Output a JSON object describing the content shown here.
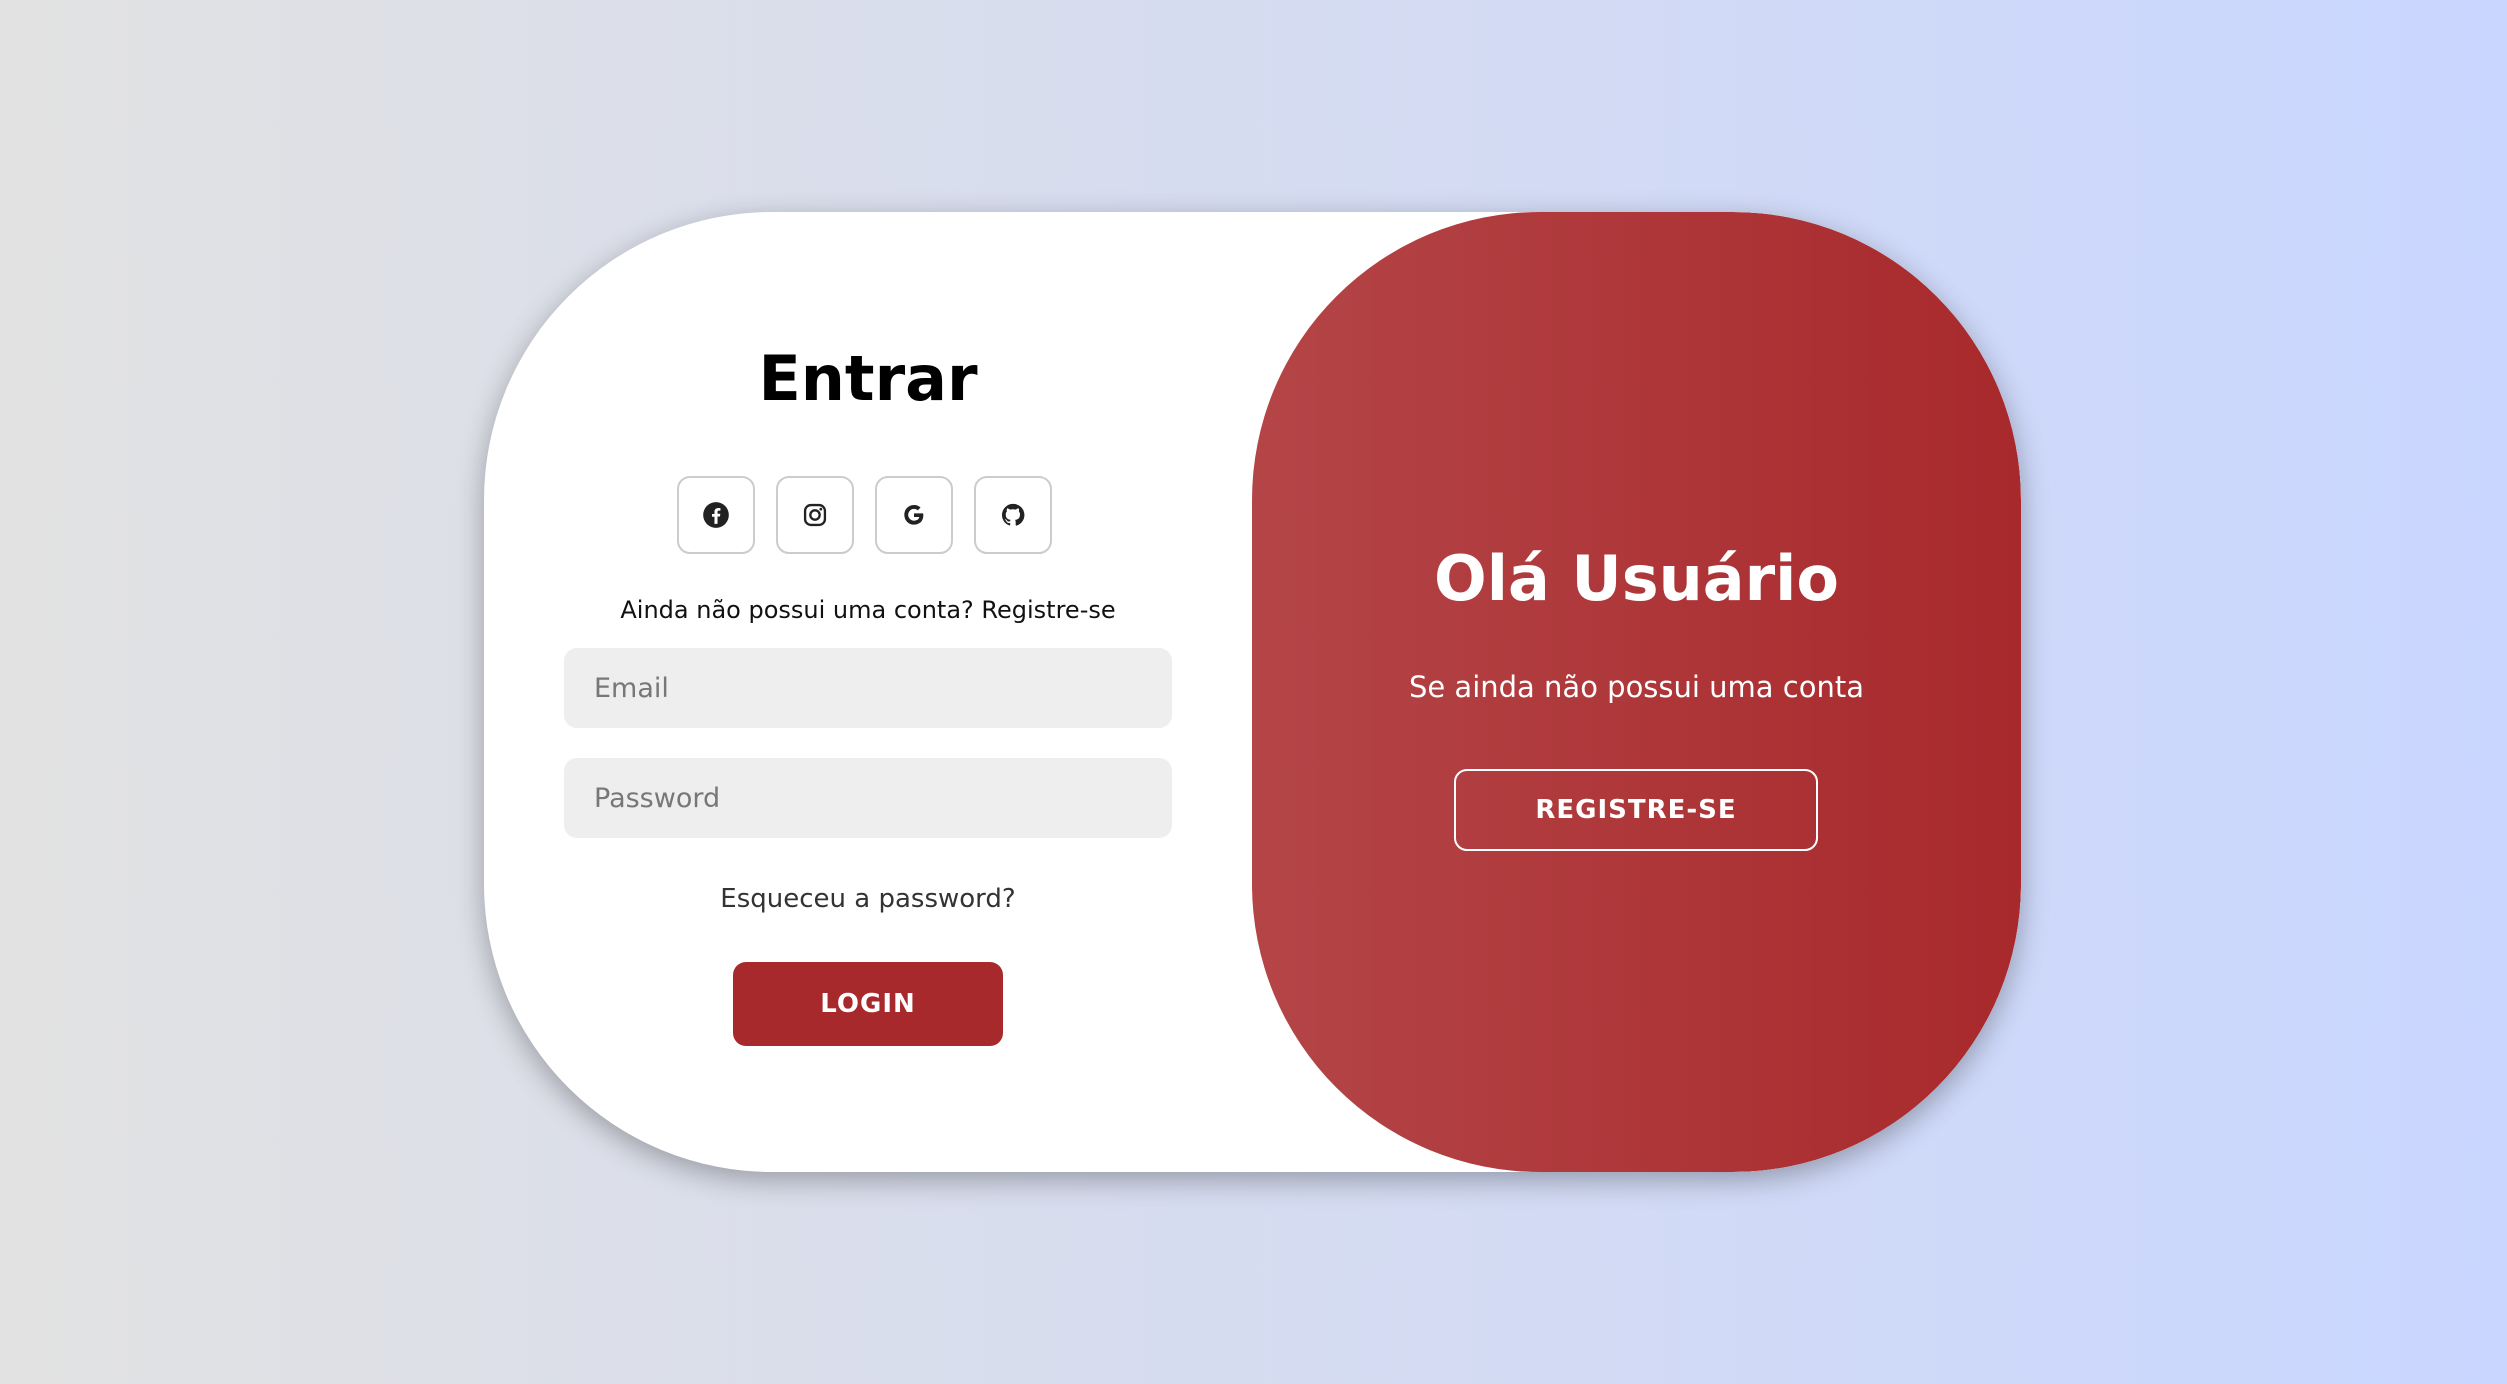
{
  "login": {
    "title": "Entrar",
    "social": [
      {
        "icon": "facebook-icon"
      },
      {
        "icon": "instagram-icon"
      },
      {
        "icon": "google-icon"
      },
      {
        "icon": "github-icon"
      }
    ],
    "signup_prompt": "Ainda não possui uma conta? Registre-se",
    "email_placeholder": "Email",
    "password_placeholder": "Password",
    "forgot_label": "Esqueceu a password?",
    "login_label": "LOGIN"
  },
  "panel": {
    "title": "Olá Usuário",
    "text": "Se ainda não possui uma conta",
    "register_label": "REGISTRE-SE"
  },
  "colors": {
    "accent": "#a8292c",
    "accent_light": "#b44547",
    "background_start": "#e2e2e2",
    "background_end": "#c9d6ff"
  }
}
